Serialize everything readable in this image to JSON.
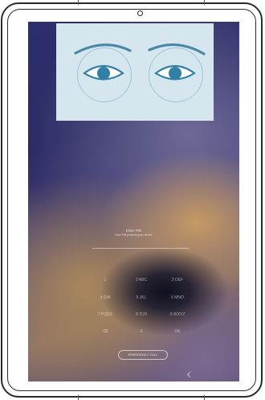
{
  "overlay": {
    "icons": [
      "eye-open-icon",
      "eye-open-icon"
    ],
    "background": "#d6e6ee",
    "accent": "#2f7fa6"
  },
  "lockscreen": {
    "title": "Enter PIN",
    "subtitle": "Your PIN protects your device",
    "keypad_rows": [
      [
        "1",
        "2 ABC",
        "3 DEF"
      ],
      [
        "4 GHI",
        "5 JKL",
        "6 MNO"
      ],
      [
        "7 PQRS",
        "8 TUV",
        "9 WXYZ"
      ],
      [
        "⌫",
        "0",
        "OK"
      ]
    ],
    "done_label": "EMERGENCY CALL"
  },
  "colors": {
    "frame": "#2a2a2a",
    "wallpaper_primary": "#2c2f6e",
    "wallpaper_accent": "#c79a63"
  }
}
